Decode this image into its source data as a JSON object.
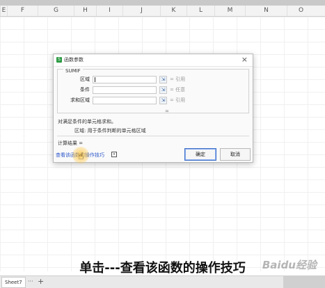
{
  "spreadsheet": {
    "columns": [
      "E",
      "F",
      "G",
      "H",
      "I",
      "J",
      "K",
      "L",
      "M",
      "N",
      "O"
    ]
  },
  "dialog": {
    "title": "函数参数",
    "close_icon": "×",
    "function_name": "SUMIF",
    "args": [
      {
        "label": "区域",
        "value": "",
        "hint": "= 引用"
      },
      {
        "label": "条件",
        "value": "",
        "hint": "= 任意"
      },
      {
        "label": "求和区域",
        "value": "",
        "hint": "= 引用"
      }
    ],
    "result_eq": "=",
    "description": "对满足条件的单元格求和。",
    "arg_description": "区域:  用于条件判断的单元格区域",
    "calc_result": "计算结果 =",
    "help_link": "查看该函数的操作技巧",
    "ok_label": "确定",
    "cancel_label": "取消"
  },
  "caption": "单击---查看该函数的操作技巧",
  "watermark": "Baidu经验",
  "sheets": {
    "active_tab": "Sheet7",
    "more": "···",
    "add": "+"
  },
  "icons": {
    "app": "spreadsheet-app-icon",
    "ref": "collapse-ref-icon",
    "help": "dropdown-icon",
    "cursor": "hand-pointer-icon"
  }
}
